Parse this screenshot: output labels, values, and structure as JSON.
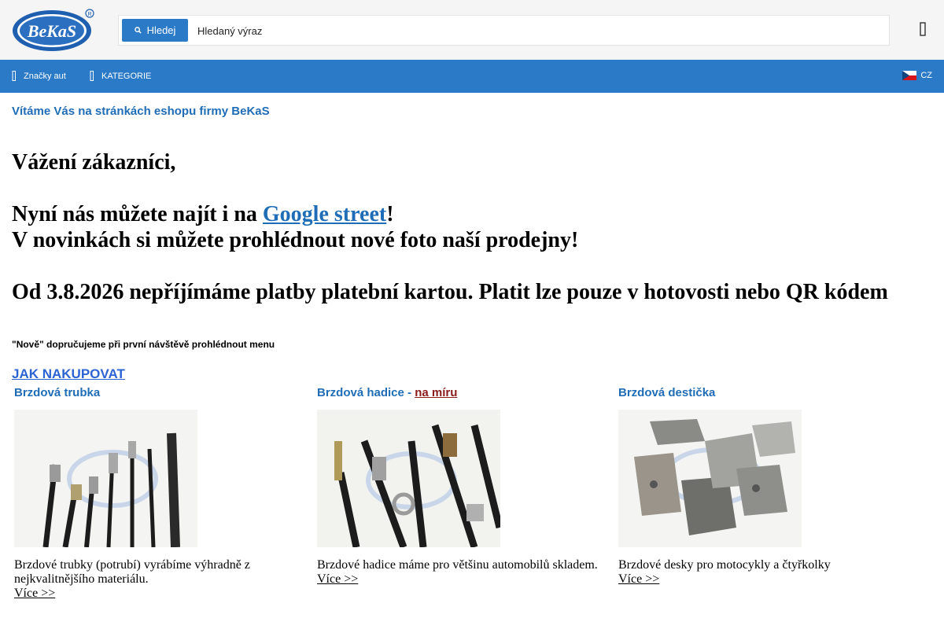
{
  "header": {
    "logo_text": "BeKaS",
    "search_button_label": "Hledej",
    "search_placeholder": "Hledaný výraz",
    "menu_icon": "hamburger-icon"
  },
  "nav": {
    "items": [
      {
        "label": "Značky aut",
        "icon": "car-brands-icon"
      },
      {
        "label": "KATEGORIE",
        "icon": "category-icon"
      }
    ],
    "language": {
      "label": "CZ",
      "icon": "czech-flag-icon"
    }
  },
  "main": {
    "welcome": "Vítáme Vás na stránkách eshopu firmy BeKaS",
    "dear": "Vážení zákazníci,",
    "google_prefix": "Nyní nás můžete najít i na ",
    "google_link": "Google street",
    "google_suffix": "!",
    "news": "V novinkách si můžete prohlédnout nové foto naší prodejny!",
    "payment": "Od 3.8.2026 nepříjímáme platby platební kartou. Platit lze pouze v hotovosti nebo QR kódem",
    "note": "\"Nově\" dopručujeme při první návštěvě prohlédnout menu",
    "how_to_buy": "JAK NAKUPOVAT"
  },
  "products": [
    {
      "title": "Brzdová trubka",
      "title_suffix_sep": "",
      "title_suffix": "",
      "description": "Brzdové trubky (potrubí) vyrábíme výhradně z nejkvalitnějšího materiálu.",
      "more": "Více >>"
    },
    {
      "title": "Brzdová hadice",
      "title_suffix_sep": " - ",
      "title_suffix": "na míru",
      "description": "Brzdové hadice máme pro většinu automobilů skladem.",
      "more": "Více >>"
    },
    {
      "title": "Brzdová destička",
      "title_suffix_sep": "",
      "title_suffix": "",
      "description": "Brzdové desky pro motocykly a čtyřkolky",
      "more": "Více >>"
    }
  ],
  "colors": {
    "brand_blue": "#2a7ac8",
    "link_blue": "#1f6db7",
    "accent_red": "#8b1a1a"
  }
}
